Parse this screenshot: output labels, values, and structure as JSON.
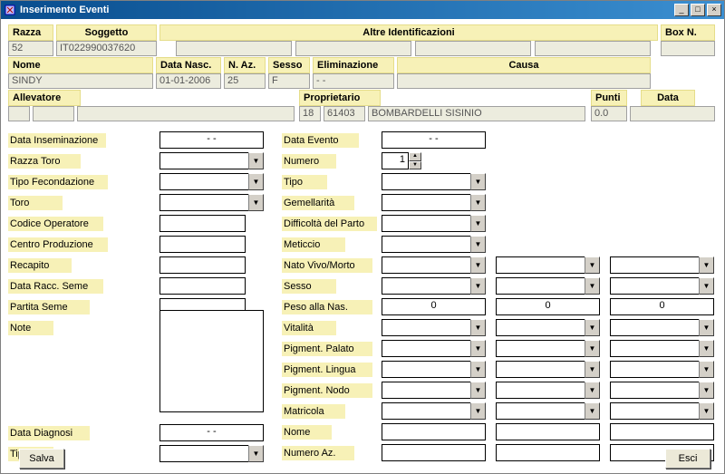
{
  "window": {
    "title": "Inserimento Eventi"
  },
  "header_row1": {
    "razza_label": "Razza",
    "razza_value": "52",
    "soggetto_label": "Soggetto",
    "soggetto_value": "IT022990037620",
    "altre_label": "Altre Identificazioni",
    "box_label": "Box N."
  },
  "header_row2": {
    "nome_label": "Nome",
    "nome_value": "SINDY",
    "datanasc_label": "Data Nasc.",
    "datanasc_value": "01-01-2006",
    "naz_label": "N. Az.",
    "naz_value": "25",
    "sesso_label": "Sesso",
    "sesso_value": "F",
    "elim_label": "Eliminazione",
    "elim_value": "- -",
    "causa_label": "Causa"
  },
  "header_row3": {
    "allevatore_label": "Allevatore",
    "proprietario_label": "Proprietario",
    "prop_code1": "18",
    "prop_code2": "61403",
    "prop_name": "BOMBARDELLI SISINIO",
    "punti_label": "Punti",
    "punti_value": "0.0",
    "data_label": "Data"
  },
  "left": {
    "datainsem": "Data Inseminazione",
    "datainsem_v": "- -",
    "razzatoro": "Razza Toro",
    "tipofec": "Tipo Fecondazione",
    "toro": "Toro",
    "codop": "Codice Operatore",
    "centroprod": "Centro Produzione",
    "recapito": "Recapito",
    "dataracc": "Data Racc. Seme",
    "partita": "Partita Seme",
    "note": "Note",
    "datadiag": "Data Diagnosi",
    "datadiag_v": "- -",
    "tipo": "Tipo"
  },
  "right": {
    "dataevento": "Data Evento",
    "dataevento_v": "- -",
    "numero": "Numero",
    "numero_v": "1",
    "tipo": "Tipo",
    "gemell": "Gemellarità",
    "diff": "Difficoltà del Parto",
    "meticcio": "Meticcio",
    "natovm": "Nato Vivo/Morto",
    "sesso": "Sesso",
    "pesonas": "Peso alla Nas.",
    "peso_v": "0",
    "vitalita": "Vitalità",
    "pigpal": "Pigment. Palato",
    "pigling": "Pigment. Lingua",
    "pignodo": "Pigment. Nodo",
    "matricola": "Matricola",
    "nome": "Nome",
    "numeroaz": "Numero Az."
  },
  "buttons": {
    "salva": "Salva",
    "esci": "Esci"
  }
}
